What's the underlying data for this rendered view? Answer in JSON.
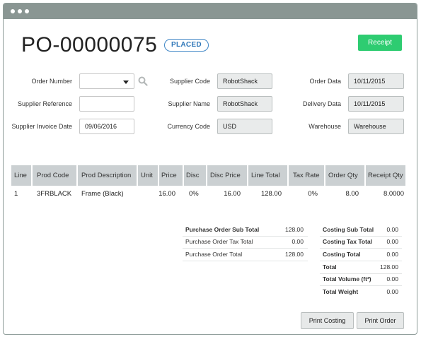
{
  "window": {
    "titlebar_dots": 3
  },
  "header": {
    "po_number": "PO-00000075",
    "status_badge": "PLACED",
    "receipt_button": "Receipt"
  },
  "form": {
    "order_number": {
      "label": "Order Number",
      "value": ""
    },
    "supplier_reference": {
      "label": "Supplier Reference",
      "value": ""
    },
    "supplier_invoice_date": {
      "label": "Supplier Invoice Date",
      "value": "09/06/2016"
    },
    "supplier_code": {
      "label": "Supplier Code",
      "value": "RobotShack"
    },
    "supplier_name": {
      "label": "Supplier Name",
      "value": "RobotShack"
    },
    "currency_code": {
      "label": "Currency Code",
      "value": "USD"
    },
    "order_data": {
      "label": "Order Data",
      "value": "10/11/2015"
    },
    "delivery_data": {
      "label": "Delivery Data",
      "value": "10/11/2015"
    },
    "warehouse": {
      "label": "Warehouse",
      "value": "Warehouse"
    }
  },
  "table": {
    "headers": [
      "Line",
      "Prod Code",
      "Prod Description",
      "Unit",
      "Price",
      "Disc",
      "Disc Price",
      "Line Total",
      "Tax Rate",
      "Order Qty",
      "Receipt Qty"
    ],
    "rows": [
      {
        "line": "1",
        "prod_code": "3FRBLACK",
        "prod_description": "Frame (Black)",
        "unit": "",
        "price": "16.00",
        "disc": "0%",
        "disc_price": "16.00",
        "line_total": "128.00",
        "tax_rate": "0%",
        "order_qty": "8.00",
        "receipt_qty": "8.0000"
      }
    ]
  },
  "summary_left": [
    {
      "label": "Purchase Order Sub Total",
      "value": "128.00"
    },
    {
      "label": "Purchase Order Tax Total",
      "value": "0.00"
    },
    {
      "label": "Purchase Order Total",
      "value": "128.00"
    }
  ],
  "summary_right": [
    {
      "label": "Costing Sub Total",
      "value": "0.00"
    },
    {
      "label": "Costing Tax Total",
      "value": "0.00"
    },
    {
      "label": "Costing Total",
      "value": "0.00"
    },
    {
      "label": "Total",
      "value": "128.00"
    },
    {
      "label": "Total Volume (ft³)",
      "value": "0.00"
    },
    {
      "label": "Total Weight",
      "value": "0.00"
    }
  ],
  "footer": {
    "print_costing": "Print Costing",
    "print_order": "Print Order"
  },
  "colors": {
    "accent_green": "#2ecc71",
    "badge_blue": "#3f86c6",
    "titlebar": "#8a9693"
  }
}
